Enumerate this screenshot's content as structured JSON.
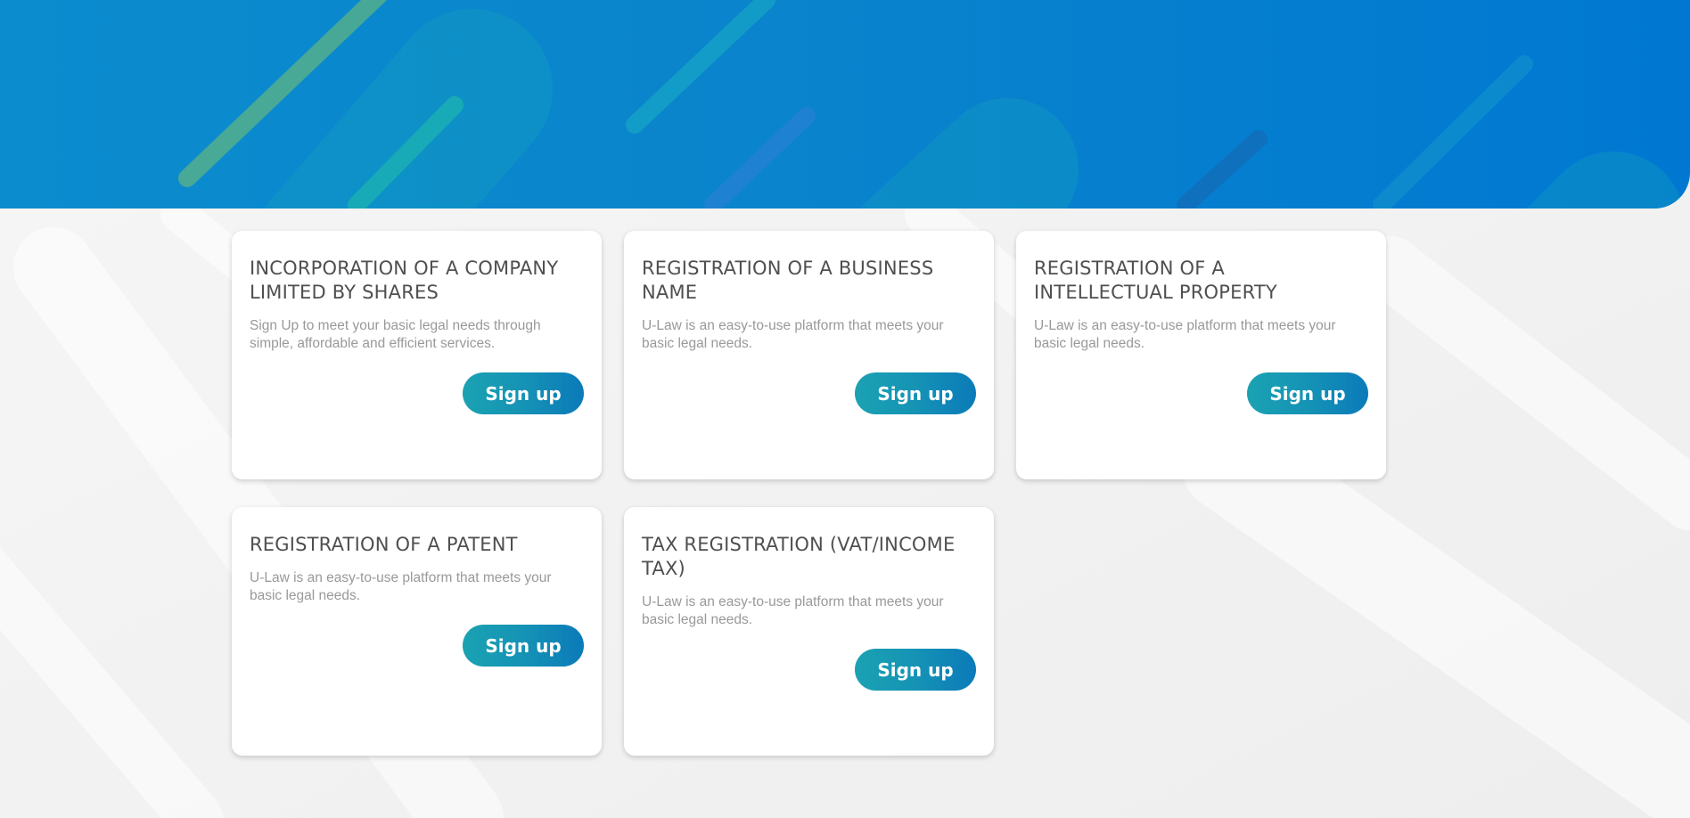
{
  "colors": {
    "hero_blue": "#0a84cc",
    "button_start": "#1aa2b2",
    "button_end": "#0b7ab9",
    "page_background": "#f1f1f1",
    "title_text": "#4f4f4f",
    "description_text": "#999999"
  },
  "cards": [
    {
      "title": "INCORPORATION OF A COMPANY LIMITED BY SHARES",
      "description": "Sign Up to meet your basic legal needs through simple, affordable and efficient services.",
      "button_label": "Sign up"
    },
    {
      "title": "REGISTRATION OF A BUSINESS NAME",
      "description": "U-Law is an easy-to-use platform that meets your basic legal needs.",
      "button_label": "Sign up"
    },
    {
      "title": "REGISTRATION OF A INTELLECTUAL PROPERTY",
      "description": "U-Law is an easy-to-use platform that meets your basic legal needs.",
      "button_label": "Sign up"
    },
    {
      "title": "REGISTRATION OF A PATENT",
      "description": "U-Law is an easy-to-use platform that meets your basic legal needs.",
      "button_label": "Sign up"
    },
    {
      "title": "TAX REGISTRATION (VAT/INCOME TAX)",
      "description": "U-Law is an easy-to-use platform that meets your basic legal needs.",
      "button_label": "Sign up"
    }
  ]
}
